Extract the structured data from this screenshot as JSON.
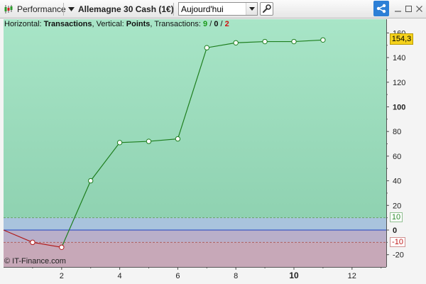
{
  "toolbar": {
    "performance_label": "Performance",
    "instrument_label": "Allemagne 30 Cash (1€)",
    "period_value": "Aujourd'hui"
  },
  "info": {
    "prefix": "Horizontal: ",
    "horizontal": "Transactions",
    "vertical_prefix": ", Vertical: ",
    "vertical": "Points",
    "trans_prefix": ", Transactions: ",
    "wins": "9",
    "neutral": "0",
    "losses": "2"
  },
  "badges": {
    "current": "154,3",
    "upper": "10",
    "lower": "-10"
  },
  "copyright": "© IT-Finance.com",
  "colors": {
    "profit_line": "#1e7e1e",
    "loss_line": "#b01818",
    "zero_line": "#2040c0",
    "current_badge": "#f5d21c"
  },
  "chart_data": {
    "type": "line",
    "x": [
      0,
      1,
      2,
      3,
      4,
      5,
      6,
      7,
      8,
      9,
      10,
      11
    ],
    "values": [
      0,
      -10,
      -14,
      40,
      71,
      72,
      74,
      148,
      152,
      153,
      153,
      154.3
    ],
    "xlabel": "",
    "ylabel": "",
    "xlim": [
      0,
      13
    ],
    "ylim": [
      -30,
      165
    ],
    "x_ticks": [
      "2",
      "4",
      "6",
      "8",
      "10",
      "12"
    ],
    "x_major_ticks": [
      "10"
    ],
    "y_ticks": [
      "-20",
      "0",
      "20",
      "40",
      "60",
      "80",
      "100",
      "120",
      "140",
      "160"
    ],
    "y_major_ticks": [
      "0",
      "100"
    ],
    "band_upper": 10,
    "band_lower": -10
  }
}
